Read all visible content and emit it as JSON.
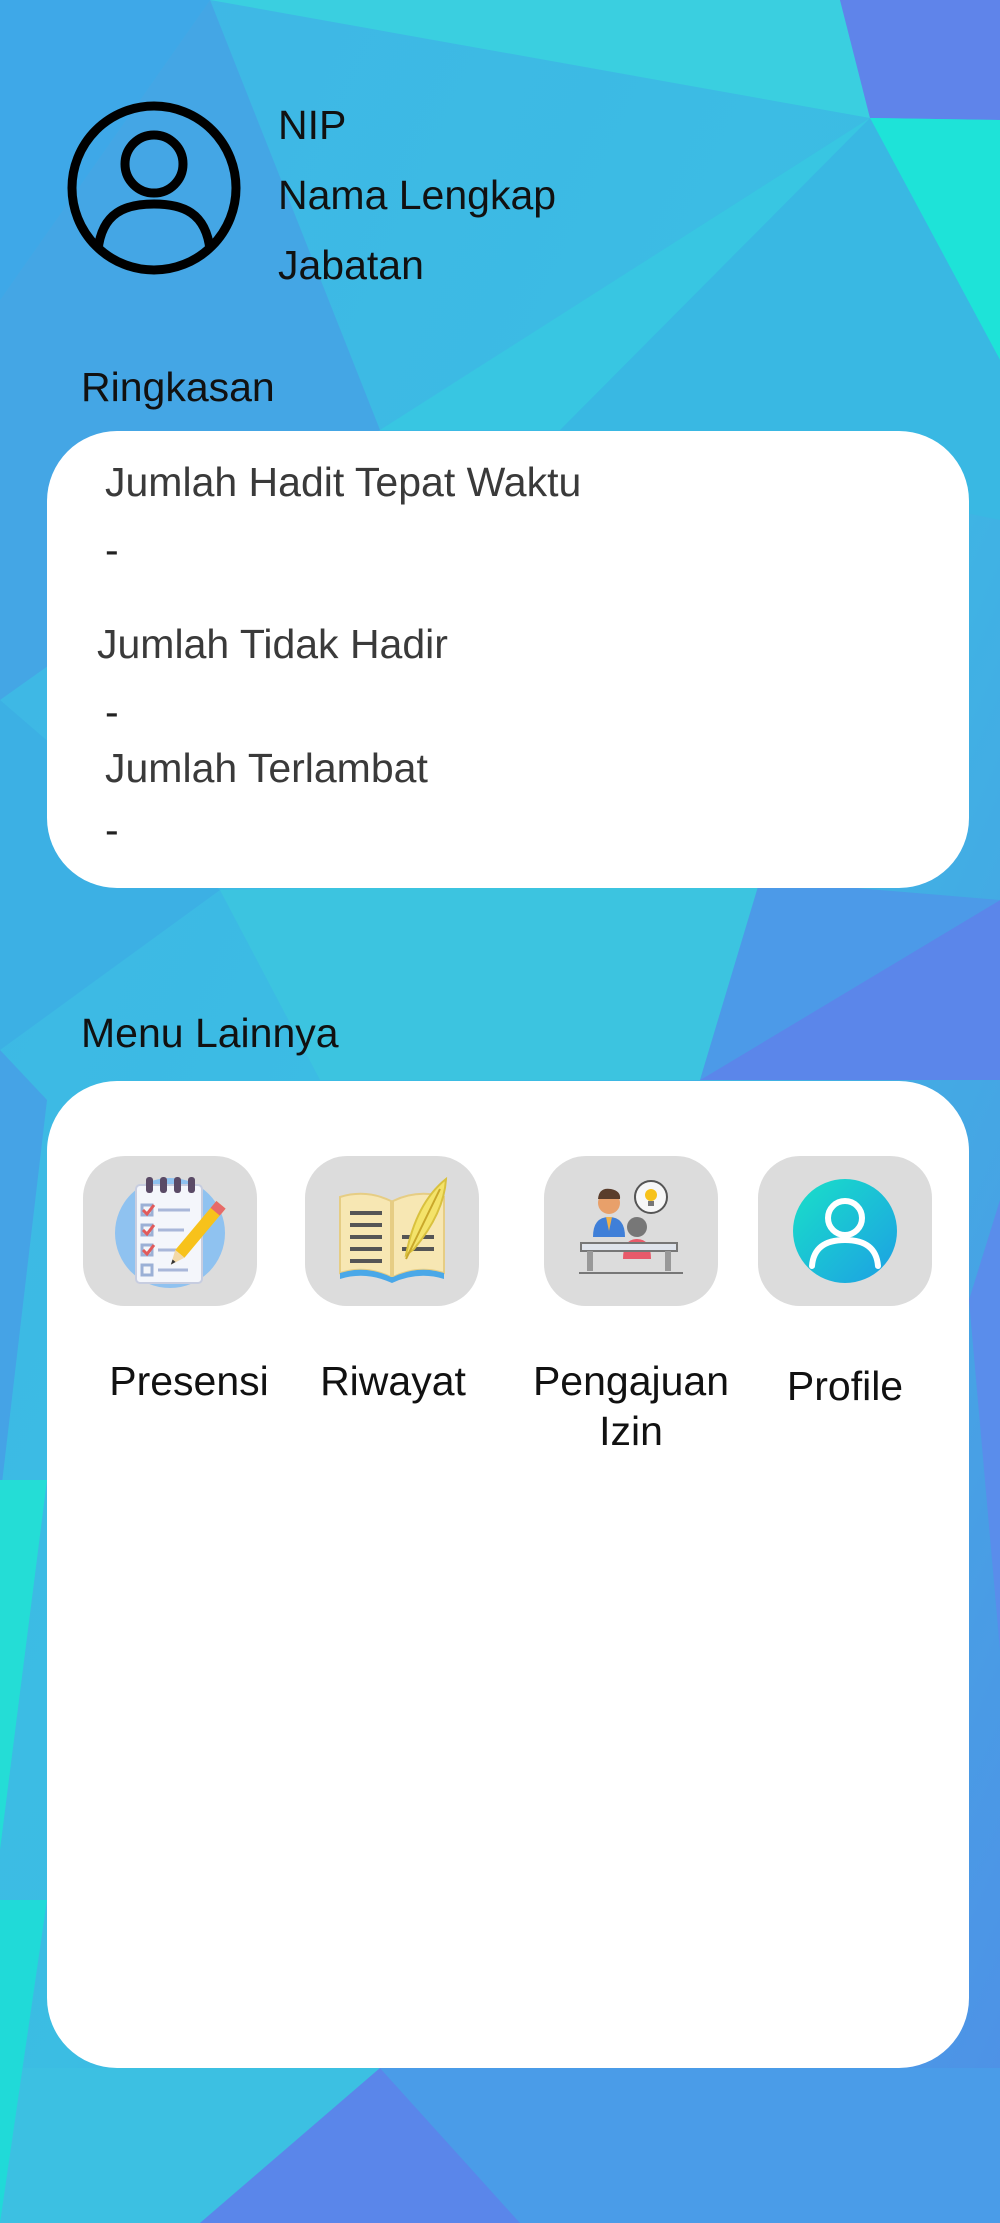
{
  "user": {
    "nip": "NIP",
    "name": "Nama Lengkap",
    "position": "Jabatan"
  },
  "summary": {
    "title": "Ringkasan",
    "items": [
      {
        "label": "Jumlah Hadit Tepat Waktu",
        "value": "-"
      },
      {
        "label": "Jumlah Tidak Hadir",
        "value": "-"
      },
      {
        "label": "Jumlah Terlambat",
        "value": "-"
      }
    ]
  },
  "menu": {
    "title": "Menu Lainnya",
    "items": [
      {
        "label": "Presensi",
        "icon": "notepad-checklist-icon"
      },
      {
        "label": "Riwayat",
        "icon": "open-book-feather-icon"
      },
      {
        "label": "Pengajuan Izin",
        "icon": "meeting-idea-icon"
      },
      {
        "label": "Profile",
        "icon": "user-profile-icon"
      }
    ]
  },
  "colors": {
    "background_primary": "#36c4e4",
    "background_secondary": "#5b86ea",
    "card": "#ffffff",
    "tile": "#dcdcdc",
    "profile_icon_gradient_start": "#19e0c8",
    "profile_icon_gradient_end": "#1d9fe4"
  }
}
